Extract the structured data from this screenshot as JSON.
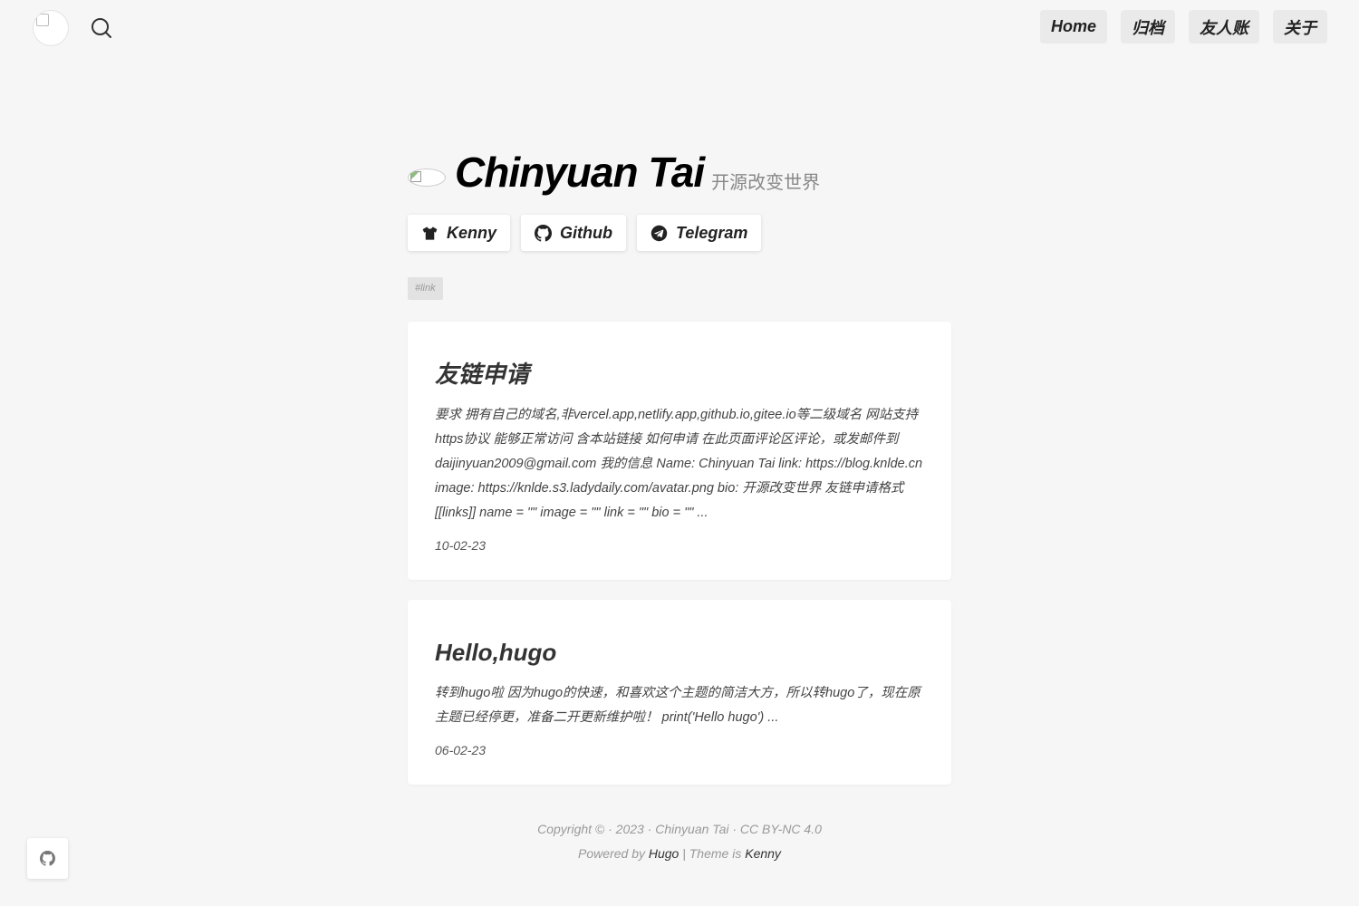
{
  "header": {
    "search_icon": "search-icon",
    "nav": [
      {
        "label": "Home"
      },
      {
        "label": "归档"
      },
      {
        "label": "友人账"
      },
      {
        "label": "关于"
      }
    ]
  },
  "profile": {
    "name": "Chinyuan Tai",
    "bio": "开源改变世界",
    "social": [
      {
        "label": "Kenny",
        "icon": "tshirt-icon"
      },
      {
        "label": "Github",
        "icon": "github-icon"
      },
      {
        "label": "Telegram",
        "icon": "telegram-icon"
      }
    ]
  },
  "tag": "#link",
  "posts": [
    {
      "title": "友链申请",
      "summary": "要求 拥有自己的域名,非vercel.app,netlify.app,github.io,gitee.io等二级域名 网站支持https协议 能够正常访问 含本站链接 如何申请 在此页面评论区评论，或发邮件到daijinyuan2009@gmail.com 我的信息 Name: Chinyuan Tai link: https://blog.knlde.cn image: https://knlde.s3.ladydaily.com/avatar.png bio: 开源改变世界 友链申请格式 [[links]] name = \"\" image = \"\" link = \"\" bio = \"\" ...",
      "date": "10-02-23"
    },
    {
      "title": "Hello,hugo",
      "summary": "转到hugo啦 因为hugo的快速，和喜欢这个主题的简洁大方，所以转hugo了，现在原主题已经停更，准备二开更新维护啦！ print('Hello hugo') ...",
      "date": "06-02-23"
    }
  ],
  "footer": {
    "copyright": "Copyright © · 2023 · Chinyuan Tai ·  CC BY-NC 4.0",
    "powered_prefix": "Powered by ",
    "powered_link": "Hugo",
    "theme_prefix": " | Theme is ",
    "theme_link": "Kenny"
  },
  "floating": {
    "icon": "github-icon"
  }
}
